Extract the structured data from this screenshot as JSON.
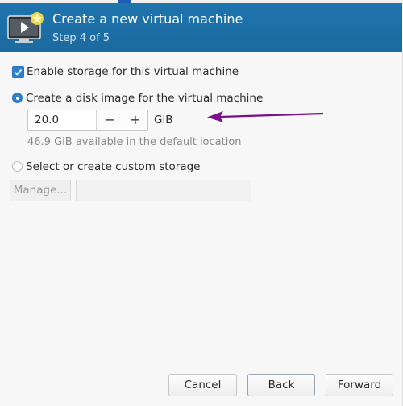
{
  "header": {
    "title": "Create a new virtual machine",
    "subtitle": "Step 4 of 5",
    "icon": "vm-monitor-play-icon"
  },
  "storage": {
    "enable_label": "Enable storage for this virtual machine",
    "enable_checked": true,
    "create_disk_label": "Create a disk image for the virtual machine",
    "create_disk_selected": true,
    "disk_size": "20.0",
    "minus_label": "−",
    "plus_label": "+",
    "unit": "GiB",
    "available_text": "46.9 GiB available in the default location",
    "custom_label": "Select or create custom storage",
    "custom_selected": false,
    "manage_label": "Manage...",
    "path_value": ""
  },
  "footer": {
    "cancel_label": "Cancel",
    "back_label": "Back",
    "forward_label": "Forward"
  },
  "colors": {
    "header_bg": "#1e6fa6",
    "accent": "#2d80d2",
    "annotation_arrow": "#7a0f8a"
  }
}
